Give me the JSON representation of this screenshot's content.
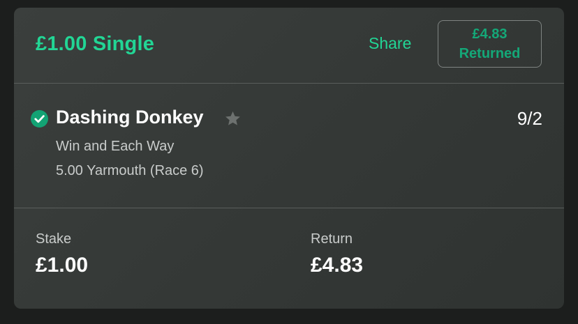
{
  "bet": {
    "title": "£1.00 Single",
    "share_label": "Share",
    "returned_amount": "£4.83",
    "returned_label": "Returned"
  },
  "selection": {
    "status": "won",
    "status_icon": "check-circle-icon",
    "favourite_icon": "star-icon",
    "runner": "Dashing Donkey",
    "odds": "9/2",
    "bet_type": "Win and Each Way",
    "event": "5.00 Yarmouth (Race 6)"
  },
  "summary": {
    "stake_label": "Stake",
    "stake_value": "£1.00",
    "return_label": "Return",
    "return_value": "£4.83"
  },
  "colors": {
    "accent": "#22d695",
    "returned_text": "#14a878",
    "card_background": "#373b39",
    "page_background": "#1c1e1d"
  }
}
